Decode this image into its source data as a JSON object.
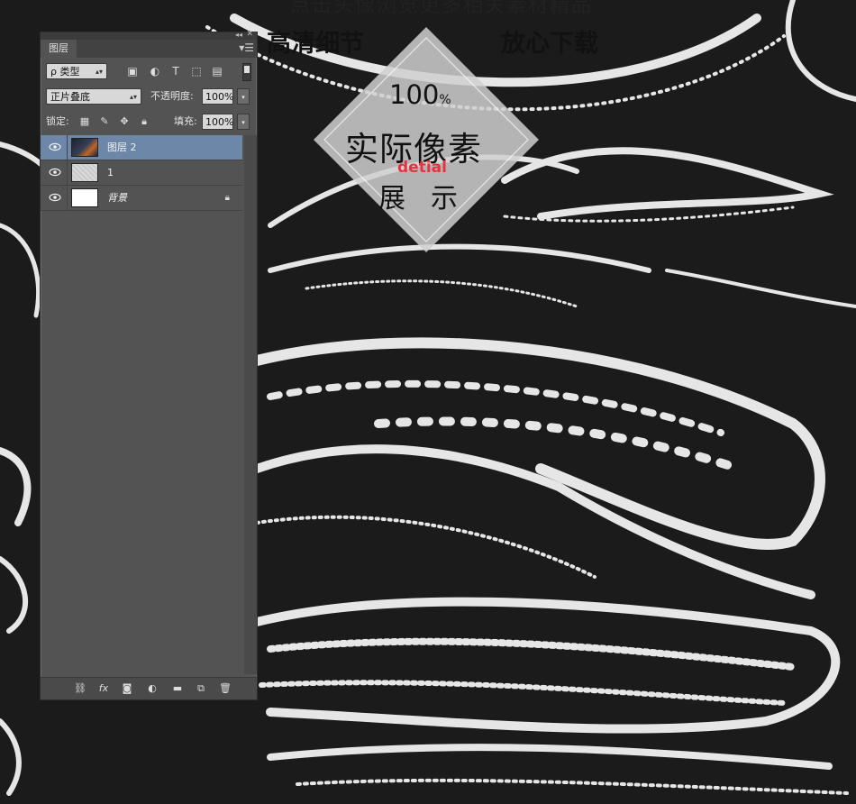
{
  "artwork": {
    "top_text": "点击头像浏览更多相关素材精品",
    "subtitle_left": "高清细节",
    "subtitle_right": "放心下载",
    "badge": {
      "percent": "100",
      "percent_sign": "%",
      "title": "实际像素",
      "detail": "detial",
      "show": "展示"
    }
  },
  "panel": {
    "tab_label": "图层",
    "filter": {
      "label": "ρ 类型",
      "icons": [
        "image-filter-icon",
        "adjustment-filter-icon",
        "text-filter-icon",
        "shape-filter-icon",
        "smart-object-filter-icon"
      ]
    },
    "blend_mode": "正片叠底",
    "opacity_label": "不透明度:",
    "opacity_value": "100%",
    "lock_label": "锁定:",
    "fill_label": "填充:",
    "fill_value": "100%",
    "layers": [
      {
        "name": "图层 2",
        "active": true,
        "thumb": "img2"
      },
      {
        "name": "1",
        "active": false,
        "thumb": "img1"
      },
      {
        "name": "背景",
        "active": false,
        "thumb": "bg",
        "locked": true
      }
    ],
    "footer_icons": [
      "link-layers-icon",
      "fx-icon",
      "mask-icon",
      "adjustment-layer-icon",
      "group-folder-icon",
      "new-layer-icon",
      "trash-icon"
    ]
  }
}
